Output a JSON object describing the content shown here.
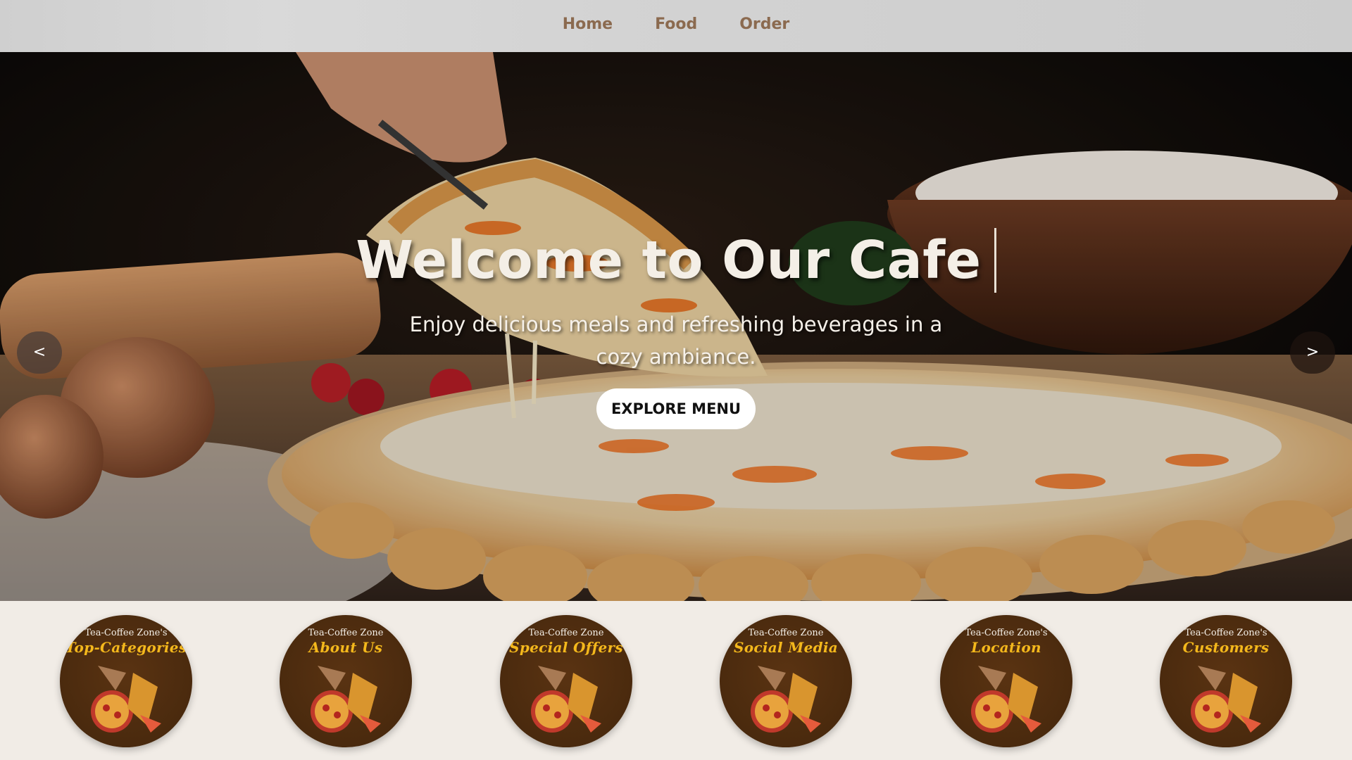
{
  "nav": {
    "links": [
      "Home",
      "Food",
      "Order"
    ]
  },
  "hero": {
    "title": "Welcome to Our Cafe",
    "subtitle": "Enjoy delicious meals and refreshing beverages in a cozy ambiance.",
    "button_label": "EXPLORE MENU",
    "prev_label": "<",
    "next_label": ">"
  },
  "categories": [
    {
      "brand": "Tea-Coffee Zone's",
      "title": "Top-Categories"
    },
    {
      "brand": "Tea-Coffee Zone",
      "title": "About Us"
    },
    {
      "brand": "Tea-Coffee Zone",
      "title": "Special Offers"
    },
    {
      "brand": "Tea-Coffee Zone",
      "title": "Social Media"
    },
    {
      "brand": "Tea-Coffee Zone's",
      "title": "Location"
    },
    {
      "brand": "Tea-Coffee Zone's",
      "title": "Customers"
    }
  ],
  "colors": {
    "nav_text": "#8b6a4f",
    "circle_bg": "#4a2a0e",
    "circle_title": "#f4b81c",
    "page_bg": "#f1ece6"
  }
}
